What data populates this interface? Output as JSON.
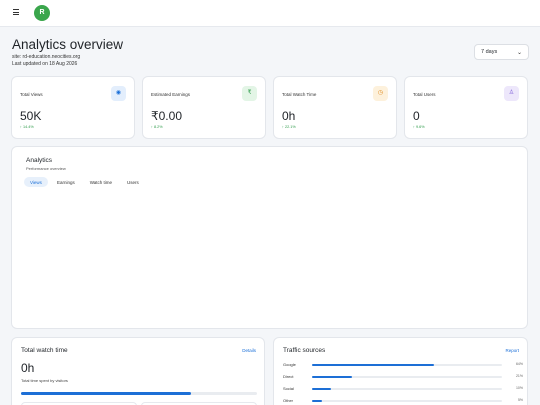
{
  "header": {
    "avatar_initial": "R",
    "avatar_color": "#3aa64c"
  },
  "page": {
    "title": "Analytics overview",
    "site": "site: rd-education.neocities.org",
    "updated": "Last updated on 18 Aug 2026"
  },
  "range_select": {
    "value": "7 days"
  },
  "stats": [
    {
      "label": "Total Views",
      "value": "50K",
      "change": "↑ 14.4%",
      "icon": "eye-icon",
      "glyph": "◉",
      "icon_bg": "#e3eefc",
      "icon_fg": "#1a6fd8"
    },
    {
      "label": "Estimated Earnings",
      "value": "₹0.00",
      "change": "↑ 8.2%",
      "icon": "rupee-icon",
      "glyph": "₹",
      "icon_bg": "#e3f5e6",
      "icon_fg": "#2e9b4a"
    },
    {
      "label": "Total Watch Time",
      "value": "0h",
      "change": "↑ 22.1%",
      "icon": "clock-icon",
      "glyph": "◷",
      "icon_bg": "#fdf1dc",
      "icon_fg": "#e0902a"
    },
    {
      "label": "Total Users",
      "value": "0",
      "change": "↑ 9.6%",
      "icon": "user-icon",
      "glyph": "♙",
      "icon_bg": "#ede7fb",
      "icon_fg": "#7a5ad8"
    }
  ],
  "analytics": {
    "title": "Analytics",
    "subtitle": "Performance overview",
    "tabs": [
      "Views",
      "Earnings",
      "Watch time",
      "Users"
    ],
    "active_tab": "Views"
  },
  "watch_time": {
    "title": "Total watch time",
    "link": "Details",
    "value": "0h",
    "description": "Total time spent by visitors",
    "progress": 0.72
  },
  "traffic": {
    "title": "Traffic sources",
    "link": "Report",
    "sources": [
      {
        "name": "Google",
        "pct_label": "64%",
        "fraction": 0.64
      },
      {
        "name": "Direct",
        "pct_label": "21%",
        "fraction": 0.21
      },
      {
        "name": "Social",
        "pct_label": "10%",
        "fraction": 0.1
      },
      {
        "name": "Other",
        "pct_label": "5%",
        "fraction": 0.05
      }
    ]
  },
  "colors": {
    "accent": "#1a6fd8",
    "positive": "#2e9b4a"
  }
}
